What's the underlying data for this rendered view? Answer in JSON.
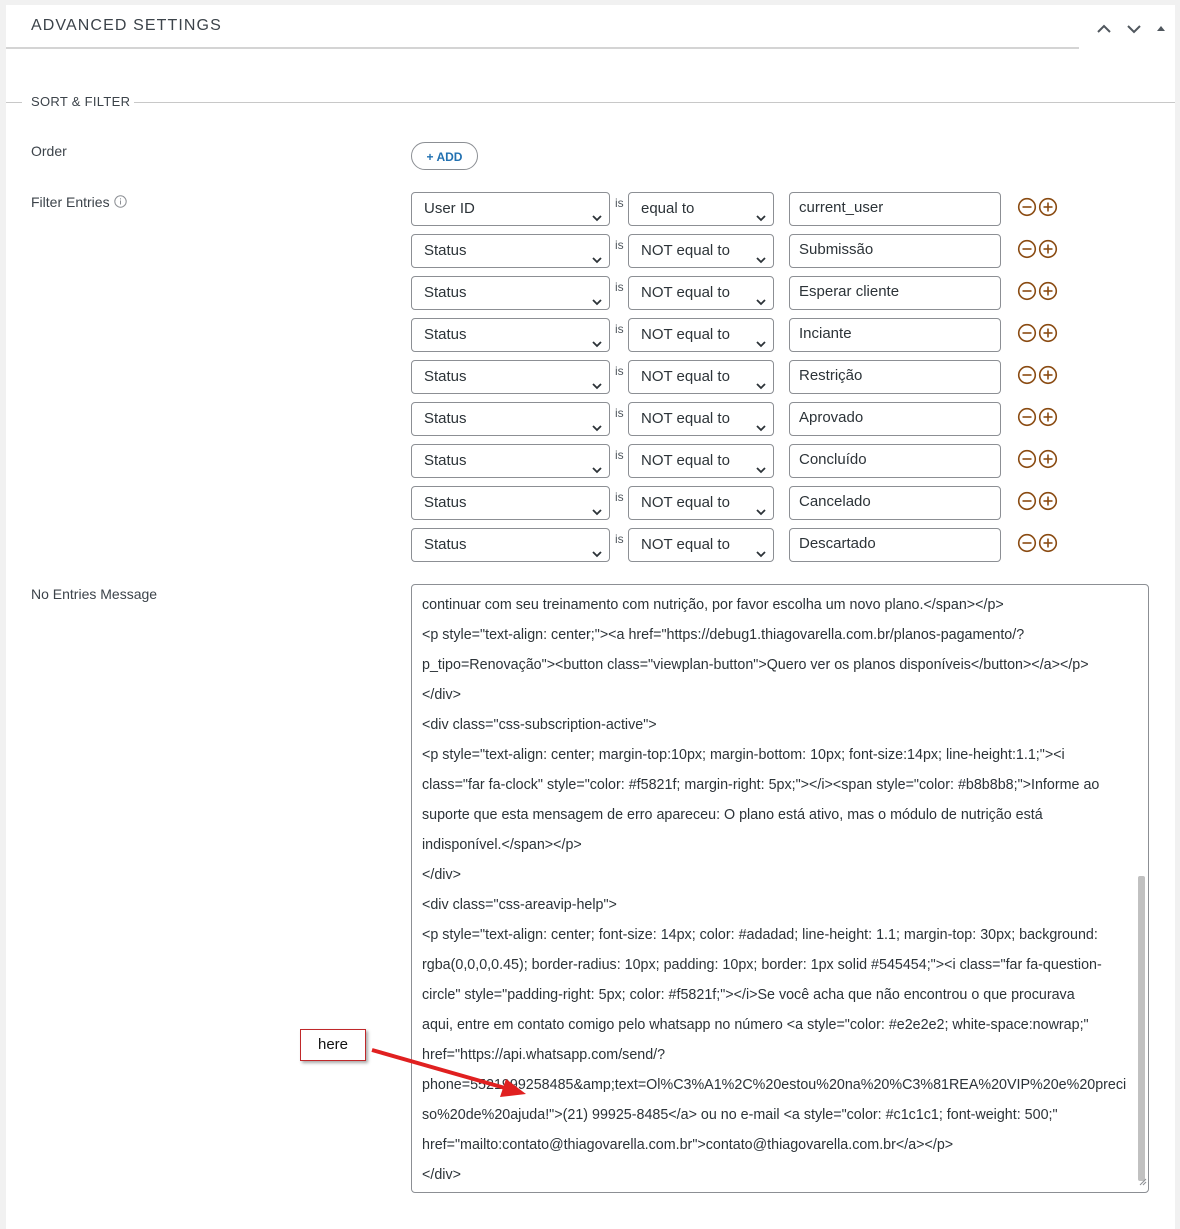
{
  "header": {
    "title": "ADVANCED SETTINGS"
  },
  "section": {
    "title": "SORT & FILTER"
  },
  "order": {
    "label": "Order",
    "add_label": "+ ADD"
  },
  "filters": {
    "label": "Filter Entries",
    "is_text": "is",
    "rows": [
      {
        "field": "User ID",
        "operator": "equal to",
        "value": "current_user"
      },
      {
        "field": "Status",
        "operator": "NOT equal to",
        "value": "Submissão"
      },
      {
        "field": "Status",
        "operator": "NOT equal to",
        "value": "Esperar cliente"
      },
      {
        "field": "Status",
        "operator": "NOT equal to",
        "value": "Inciante"
      },
      {
        "field": "Status",
        "operator": "NOT equal to",
        "value": "Restrição"
      },
      {
        "field": "Status",
        "operator": "NOT equal to",
        "value": "Aprovado"
      },
      {
        "field": "Status",
        "operator": "NOT equal to",
        "value": "Concluído"
      },
      {
        "field": "Status",
        "operator": "NOT equal to",
        "value": "Cancelado"
      },
      {
        "field": "Status",
        "operator": "NOT equal to",
        "value": "Descartado"
      }
    ]
  },
  "no_entries": {
    "label": "No Entries Message",
    "lines": [
      "continuar com seu treinamento com nutrição, por favor escolha um novo plano.</span></p>",
      "<p style=\"text-align: center;\"><a href=\"https://debug1.thiagovarella.com.br/planos-pagamento/?",
      "p_tipo=Renovação\"><button class=\"viewplan-button\">Quero ver os planos disponíveis</button></a></p>",
      "</div>",
      "<div class=\"css-subscription-active\">",
      "<p style=\"text-align: center; margin-top:10px; margin-bottom: 10px; font-size:14px; line-height:1.1;\"><i",
      "class=\"far fa-clock\" style=\"color: #f5821f; margin-right: 5px;\"></i><span style=\"color: #b8b8b8;\">Informe ao",
      "suporte que esta mensagem de erro apareceu: O plano está ativo, mas o módulo de nutrição está",
      "indisponível.</span></p>",
      "</div>",
      "<div class=\"css-areavip-help\">",
      "<p style=\"text-align: center; font-size: 14px; color: #adadad; line-height: 1.1; margin-top: 30px; background:",
      "rgba(0,0,0,0.45); border-radius: 10px; padding: 10px; border: 1px solid #545454;\"><i class=\"far fa-question-",
      "circle\" style=\"padding-right: 5px; color: #f5821f;\"></i>Se você acha que não encontrou o que procurava",
      "aqui, entre em contato comigo pelo whatsapp no número <a style=\"color: #e2e2e2; white-space:nowrap;\"",
      "href=\"https://api.whatsapp.com/send/?",
      "phone=5521999258485&amp;text=Ol%C3%A1%2C%20estou%20na%20%C3%81REA%20VIP%20e%20preci",
      "so%20de%20ajuda!\">(21) 99925-8485</a> ou no e-mail <a style=\"color: #c1c1c1; font-weight: 500;\"",
      "href=\"mailto:contato@thiagovarella.com.br\">contato@thiagovarella.com.br</a></p>",
      "</div>"
    ]
  },
  "annotation": {
    "callout_text": "here",
    "color": "#e02020"
  },
  "colors": {
    "control_icon": "#8a4b12",
    "link_blue": "#2271b1"
  },
  "icons": {
    "collapse_up": "chevron-up-icon",
    "expand_down": "chevron-down-icon",
    "toggle": "triangle-up-icon",
    "info": "info-icon",
    "remove": "minus-circle-icon",
    "add": "plus-circle-icon"
  }
}
